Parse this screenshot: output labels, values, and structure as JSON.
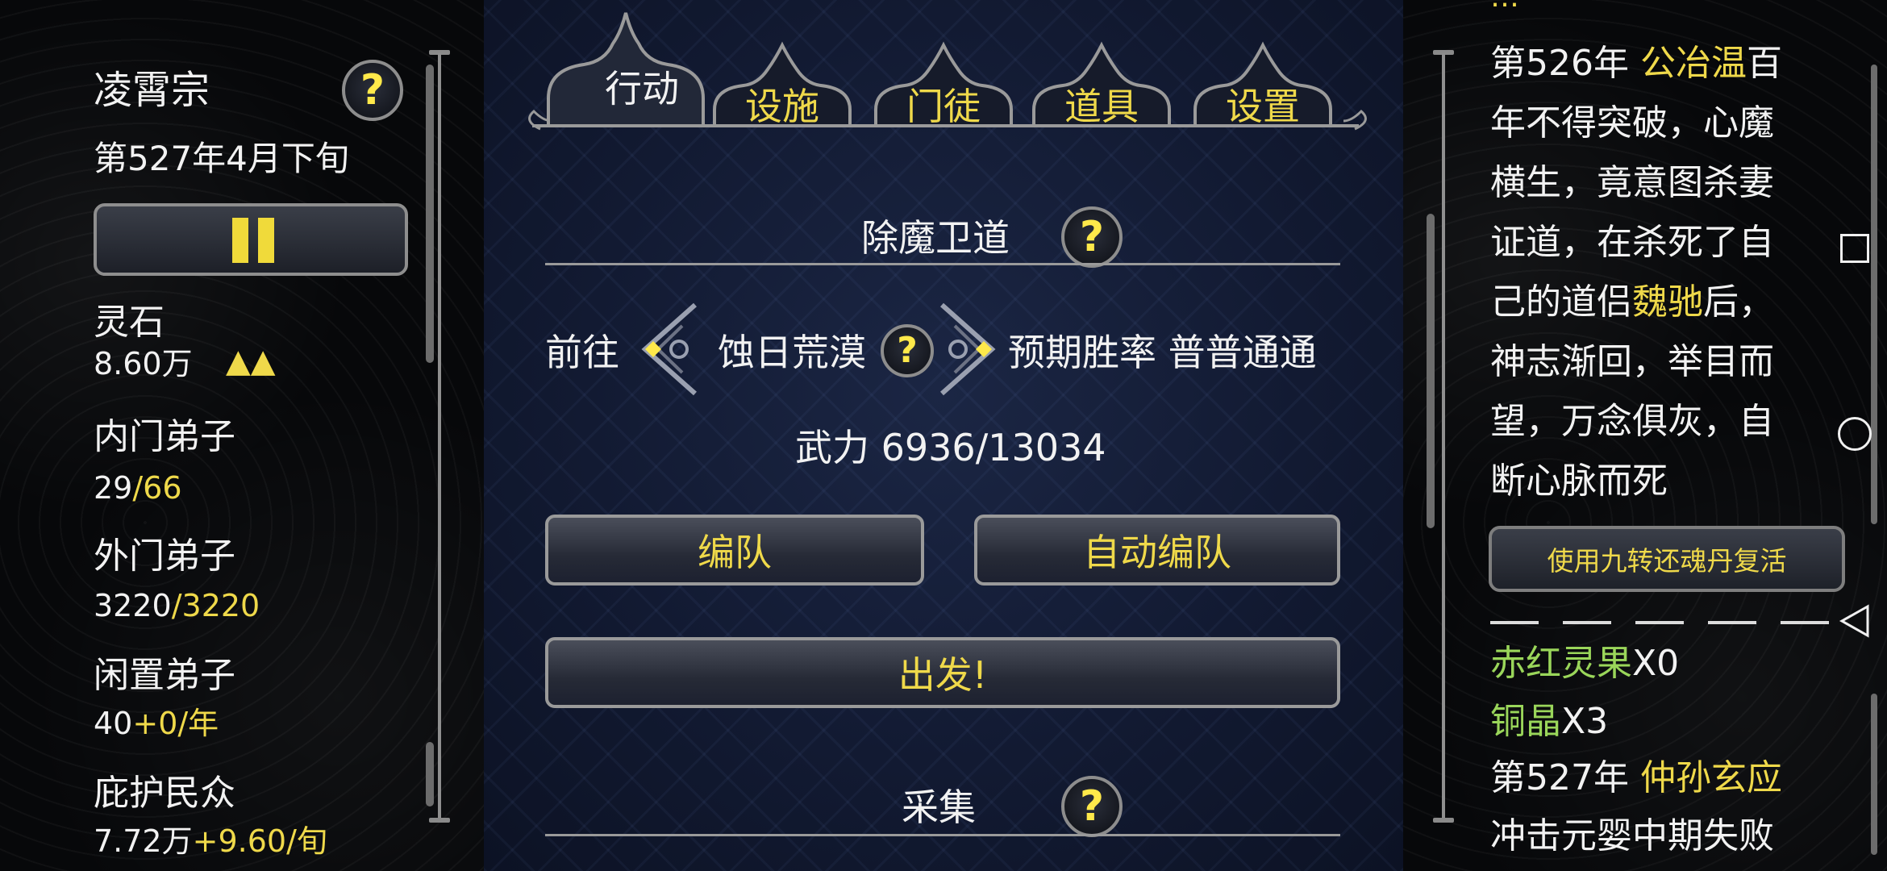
{
  "left": {
    "sect_name": "凌霄宗",
    "date": "第527年4月下旬",
    "spirit_stone_label": "灵石",
    "spirit_stone_value": "8.60万",
    "spirit_stone_trend": "▲▲",
    "inner_label": "内门弟子",
    "inner_current": "29",
    "inner_max": "/66",
    "outer_label": "外门弟子",
    "outer_current": "3220",
    "outer_max": "/3220",
    "idle_label": "闲置弟子",
    "idle_value": "40",
    "idle_rate": "+0/年",
    "protect_label": "庇护民众",
    "protect_value": "7.72万",
    "protect_rate": "+9.60/旬"
  },
  "tabs": [
    {
      "label": "行动",
      "active": true
    },
    {
      "label": "设施",
      "active": false
    },
    {
      "label": "门徒",
      "active": false
    },
    {
      "label": "道具",
      "active": false
    },
    {
      "label": "设置",
      "active": false
    }
  ],
  "action": {
    "section_title": "除魔卫道",
    "goto_label": "前往",
    "destination": "蚀日荒漠",
    "win_rate_label": "预期胜率",
    "win_rate_value": "普普通通",
    "power_text": "武力 6936/13034",
    "formation_button": "编队",
    "auto_formation_button": "自动编队",
    "depart_button": "出发!",
    "gather_title": "采集"
  },
  "log": {
    "lines": [
      {
        "text": "第526年 ",
        "hl": "公冶温",
        "rest": "百"
      },
      {
        "text": "年不得突破，心魔"
      },
      {
        "text": "横生，竟意图杀妻"
      },
      {
        "text": "证道，在杀死了自"
      },
      {
        "text": "己的道侣",
        "hl": "魏驰",
        "rest": "后，"
      },
      {
        "text": "神志渐回，举目而"
      },
      {
        "text": "望，万念俱灰，自"
      },
      {
        "text": "断心脉而死"
      }
    ],
    "revive_button": "使用九转还魂丹复活",
    "items": [
      {
        "name": "赤红灵果",
        "count": "X0"
      },
      {
        "name": "铜晶",
        "count": "X3"
      }
    ],
    "event_year": "第527年 ",
    "event_name": "仲孙玄应",
    "event_text": "冲击元婴中期失败"
  },
  "colors": {
    "gold": "#efd94a",
    "green": "#9ad65a",
    "panel_blue": "#121a32"
  },
  "system_nav": [
    "recent-apps",
    "home",
    "back"
  ]
}
